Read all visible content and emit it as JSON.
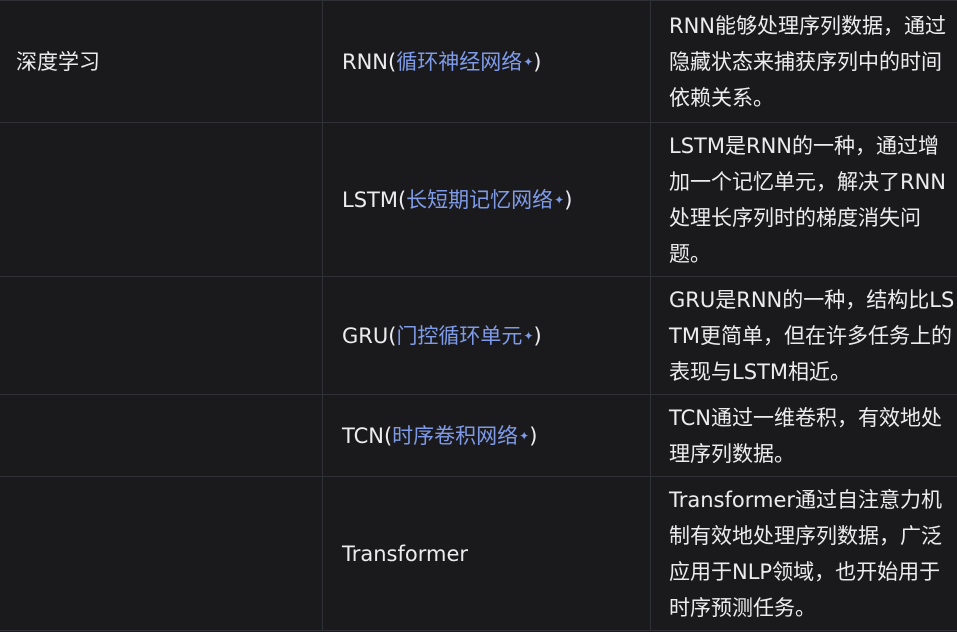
{
  "table": {
    "rows": [
      {
        "category": "深度学习",
        "model_prefix": "RNN(",
        "model_link": "循环神经网络",
        "model_suffix": ")",
        "description": "RNN能够处理序列数据，通过隐藏状态来捕获序列中的时间依赖关系。"
      },
      {
        "category": "",
        "model_prefix": "LSTM(",
        "model_link": "长短期记忆网络",
        "model_suffix": ")",
        "description": "LSTM是RNN的一种，通过增加一个记忆单元，解决了RNN处理长序列时的梯度消失问题。"
      },
      {
        "category": "",
        "model_prefix": "GRU(",
        "model_link": "门控循环单元",
        "model_suffix": ")",
        "description": "GRU是RNN的一种，结构比LSTM更简单，但在许多任务上的表现与LSTM相近。"
      },
      {
        "category": "",
        "model_prefix": "TCN(",
        "model_link": "时序卷积网络",
        "model_suffix": ")",
        "description": "TCN通过一维卷积，有效地处理序列数据。"
      },
      {
        "category": "",
        "model_prefix": "Transformer",
        "model_link": "",
        "model_suffix": "",
        "description": "Transformer通过自注意力机制有效地处理序列数据，广泛应用于NLP领域，也开始用于时序预测任务。"
      }
    ],
    "link_icon": "sparkle-icon",
    "link_color": "#7f9be8",
    "border_color": "#2f3136",
    "background": "#1a1a1d"
  }
}
